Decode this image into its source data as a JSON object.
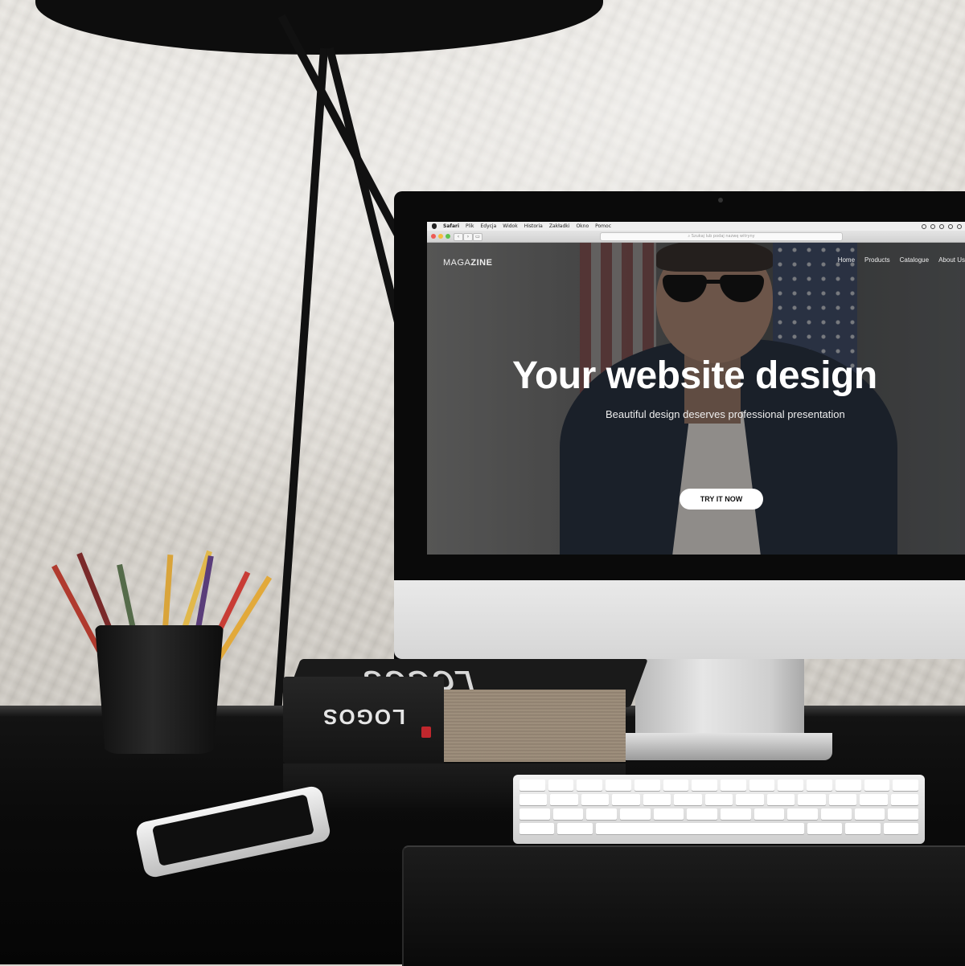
{
  "browser": {
    "menu": [
      "Safari",
      "Plik",
      "Edycja",
      "Widok",
      "Historia",
      "Zakładki",
      "Okno",
      "Pomoc"
    ],
    "address_placeholder": "Szukaj lub podaj nazwę witryny"
  },
  "site": {
    "logo_light": "MAGA",
    "logo_bold": "ZINE",
    "nav": [
      "Home",
      "Products",
      "Catalogue",
      "About Us"
    ],
    "hero_title": "Your website design",
    "hero_subtitle": "Beautiful design deserves professional presentation",
    "cta_label": "TRY IT NOW"
  },
  "book": {
    "cover_title": "LOGOS",
    "spine_title": "LOGOS"
  },
  "colors": {
    "desk": "#0b0b0b",
    "wall": "#e2ded8",
    "cta_bg": "#ffffff",
    "badge_red": "#c0272d"
  }
}
